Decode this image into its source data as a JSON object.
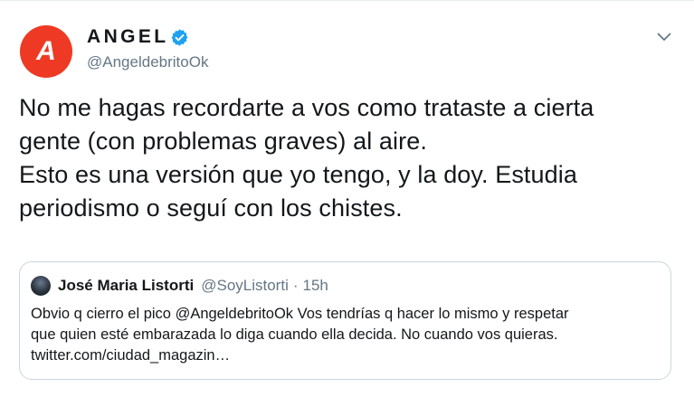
{
  "author": {
    "avatar_letter": "A",
    "display_name": "ANGEL",
    "handle": "@AngeldebritoOk",
    "verified": true
  },
  "tweet": {
    "lines": [
      "No me hagas recordarte a vos como trataste a cierta",
      "gente (con problemas graves) al aire.",
      "Esto es una versión que yo tengo, y la doy. Estudia",
      "periodismo o seguí con los chistes."
    ]
  },
  "quoted_tweet": {
    "display_name": "José Maria Listorti",
    "handle": "@SoyListorti",
    "separator": "·",
    "time": "15h",
    "lines": [
      "Obvio q cierro el pico @AngeldebritoOk Vos tendrías q hacer lo mismo y respetar",
      "que quien esté embarazada lo diga cuando ella decida. No cuando vos quieras.",
      "twitter.com/ciudad_magazin…"
    ]
  },
  "icons": {
    "verified": "verified-badge-icon",
    "menu": "chevron-down-icon"
  },
  "colors": {
    "avatar_bg": "#ee3a24",
    "verified": "#1da1f2",
    "text": "#14171a",
    "secondary_text": "#657786",
    "border": "#ccd6dd"
  }
}
